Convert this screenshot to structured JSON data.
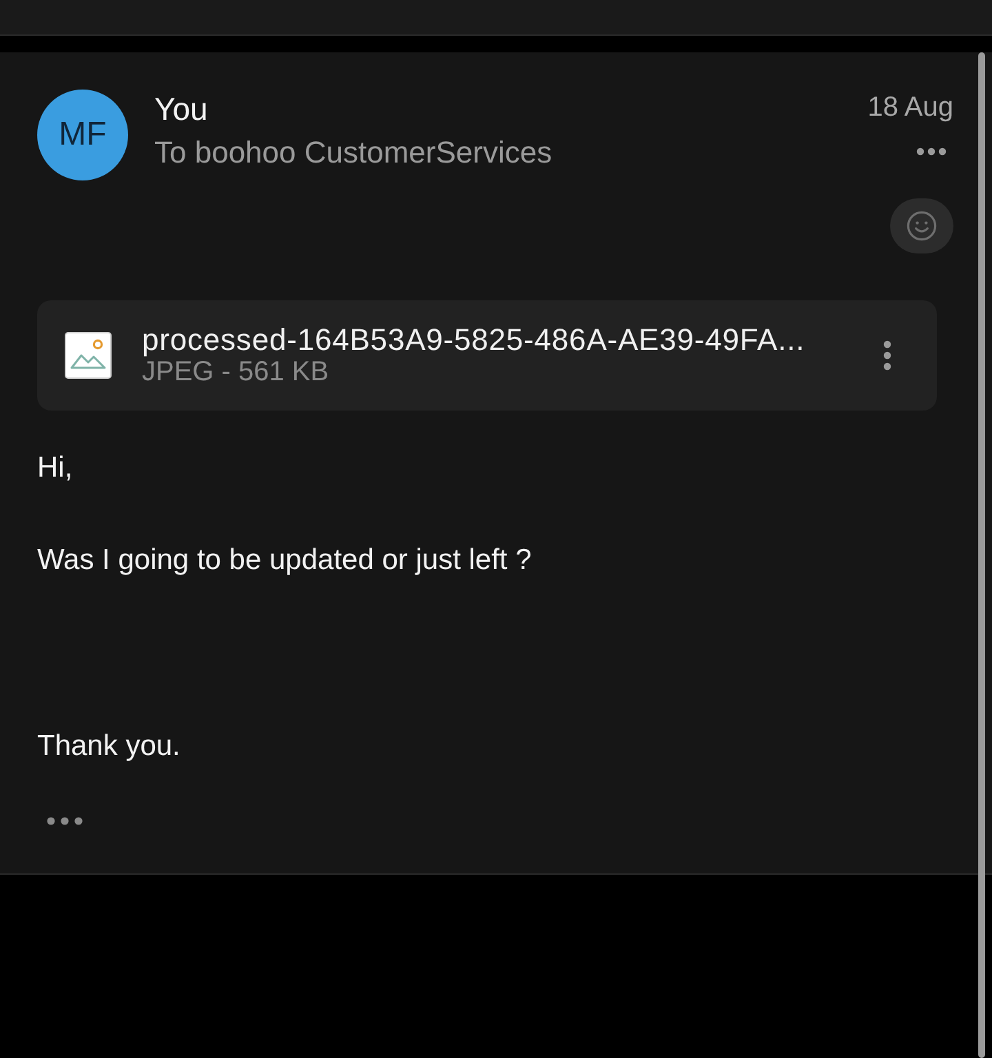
{
  "message": {
    "avatar": {
      "initials": "MF"
    },
    "sender": "You",
    "recipient": "To boohoo CustomerServices",
    "date": "18 Aug",
    "attachment": {
      "file_name": "processed-164B53A9-5825-486A-AE39-49FA...",
      "details": "JPEG - 561 KB"
    },
    "body": [
      {
        "kind": "greeting",
        "text": "Hi,"
      },
      {
        "kind": "text",
        "text": "Was I going to be updated or just left ?"
      },
      {
        "kind": "closing",
        "text": "Thank you."
      }
    ]
  }
}
